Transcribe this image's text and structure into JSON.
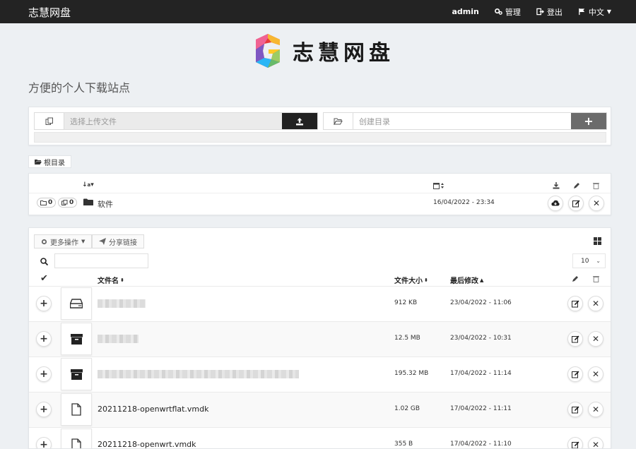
{
  "navbar": {
    "brand": "志慧网盘",
    "user": "admin",
    "manage": "管理",
    "logout": "登出",
    "language": "中文"
  },
  "logo": {
    "text": "志慧网盘",
    "letter": "G"
  },
  "subtitle": "方便的个人下载站点",
  "upload": {
    "file_placeholder": "选择上传文件",
    "dir_placeholder": "创建目录"
  },
  "breadcrumb": {
    "root": "根目录"
  },
  "directories": [
    {
      "name": "软件",
      "folders": "0",
      "files": "0",
      "modified": "16/04/2022 - 23:34"
    }
  ],
  "toolbar": {
    "more_actions": "更多操作",
    "share_link": "分享链接",
    "per_page": "10"
  },
  "table_headers": {
    "name": "文件名",
    "size": "文件大小",
    "modified": "最后修改"
  },
  "files": [
    {
      "name": "",
      "size": "912 KB",
      "modified": "23/04/2022 - 11:06",
      "icon": "hard-drive-icon"
    },
    {
      "name": "",
      "size": "12.5 MB",
      "modified": "23/04/2022 - 10:31",
      "icon": "archive-icon"
    },
    {
      "name": "",
      "size": "195.32 MB",
      "modified": "17/04/2022 - 11:14",
      "icon": "archive-icon"
    },
    {
      "name": "20211218-openwrtflat.vmdk",
      "size": "1.02 GB",
      "modified": "17/04/2022 - 11:11",
      "icon": "file-icon"
    },
    {
      "name": "20211218-openwrt.vmdk",
      "size": "355 B",
      "modified": "17/04/2022 - 11:10",
      "icon": "file-icon"
    }
  ],
  "colors": {
    "navbar": "#232323",
    "background": "#edf0f3",
    "upload_button": "#222222",
    "mkdir_button": "#6b6b6b"
  }
}
